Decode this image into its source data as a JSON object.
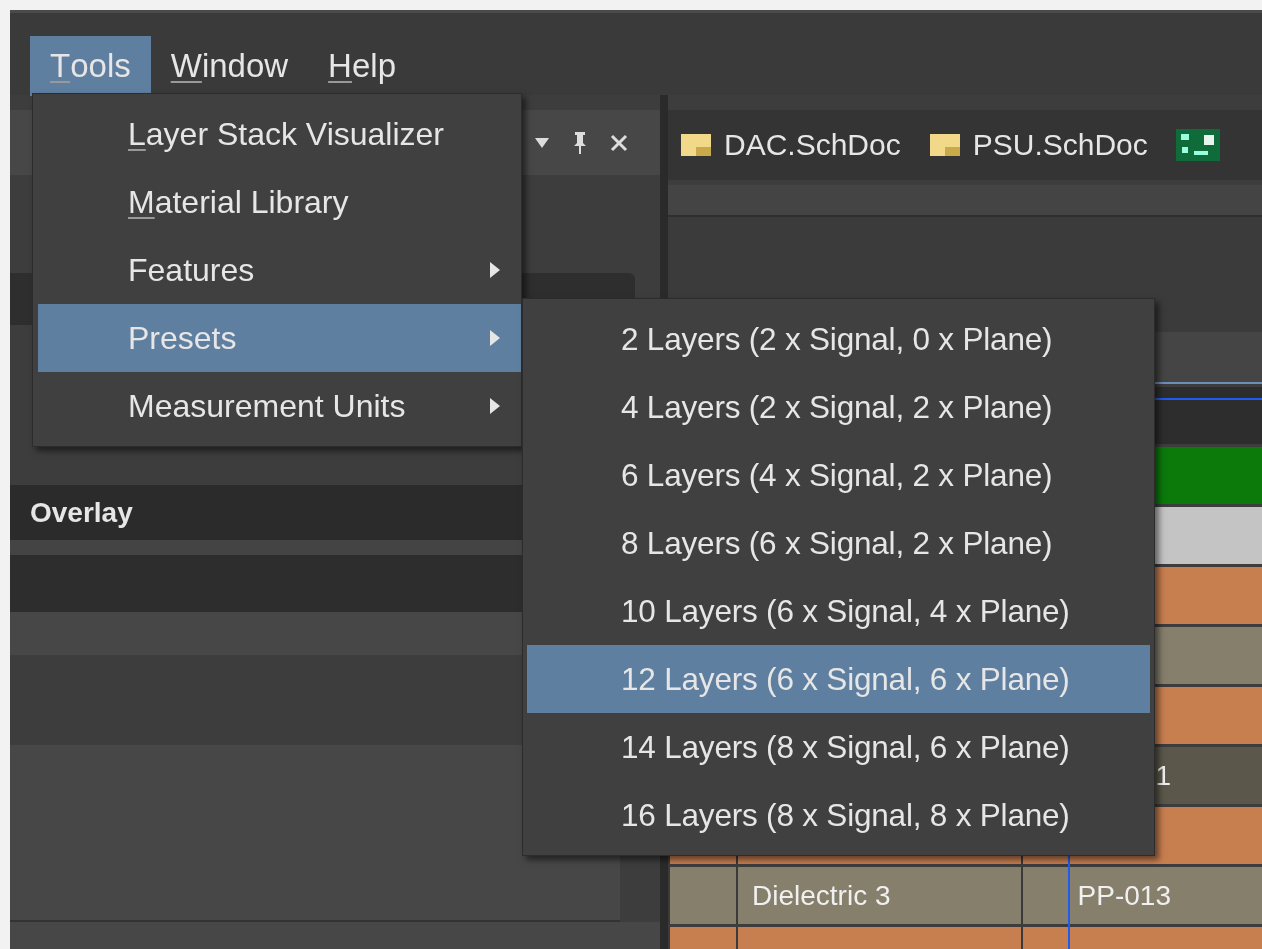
{
  "menubar": [
    {
      "label": "Tools",
      "selected": true,
      "underline_first": true
    },
    {
      "label": "Window",
      "selected": false,
      "underline_first": true
    },
    {
      "label": "Help",
      "selected": false,
      "underline_first": true
    }
  ],
  "tools_menu": {
    "items": [
      {
        "label": "Layer Stack Visualizer",
        "underline_first": true,
        "has_submenu": false,
        "selected": false
      },
      {
        "label": "Material Library",
        "underline_first": true,
        "has_submenu": false,
        "selected": false
      },
      {
        "label": "Features",
        "underline_first": false,
        "has_submenu": true,
        "selected": false
      },
      {
        "label": "Presets",
        "underline_first": false,
        "has_submenu": true,
        "selected": true
      },
      {
        "label": "Measurement Units",
        "underline_first": false,
        "has_submenu": true,
        "selected": false
      }
    ]
  },
  "presets_submenu": {
    "items": [
      {
        "label": "2 Layers (2 x Signal, 0 x Plane)",
        "selected": false
      },
      {
        "label": "4 Layers (2 x Signal, 2 x Plane)",
        "selected": false
      },
      {
        "label": "6 Layers (4 x Signal, 2 x Plane)",
        "selected": false
      },
      {
        "label": "8 Layers (6 x Signal, 2 x Plane)",
        "selected": false
      },
      {
        "label": "10 Layers (6 x Signal, 4 x Plane)",
        "selected": false
      },
      {
        "label": "12 Layers (6 x Signal, 6 x Plane)",
        "selected": true
      },
      {
        "label": "14 Layers (8 x Signal, 6 x Plane)",
        "selected": false
      },
      {
        "label": "16 Layers (8 x Signal, 8 x Plane)",
        "selected": false
      }
    ]
  },
  "panel": {
    "row_label": "Overlay"
  },
  "document_tabs": [
    {
      "label": "DAC.SchDoc",
      "kind": "schematic"
    },
    {
      "label": "PSU.SchDoc",
      "kind": "schematic"
    },
    {
      "kind": "pcb"
    }
  ],
  "layer_table": {
    "rows": [
      {
        "color": "#2d2d2d"
      },
      {
        "color": "#0b7a0b"
      },
      {
        "color": "#c4c4c4"
      },
      {
        "color": "#c87f50"
      },
      {
        "color": "#857f6c"
      },
      {
        "color": "#c87f50"
      },
      {
        "color": "#5b574a",
        "column_3": "1"
      },
      {
        "color": "#c87f50"
      },
      {
        "color": "#857f6c",
        "column_2": "Dielectric 3",
        "column_3": "PP-013"
      },
      {
        "color": "#c87f50"
      }
    ]
  }
}
